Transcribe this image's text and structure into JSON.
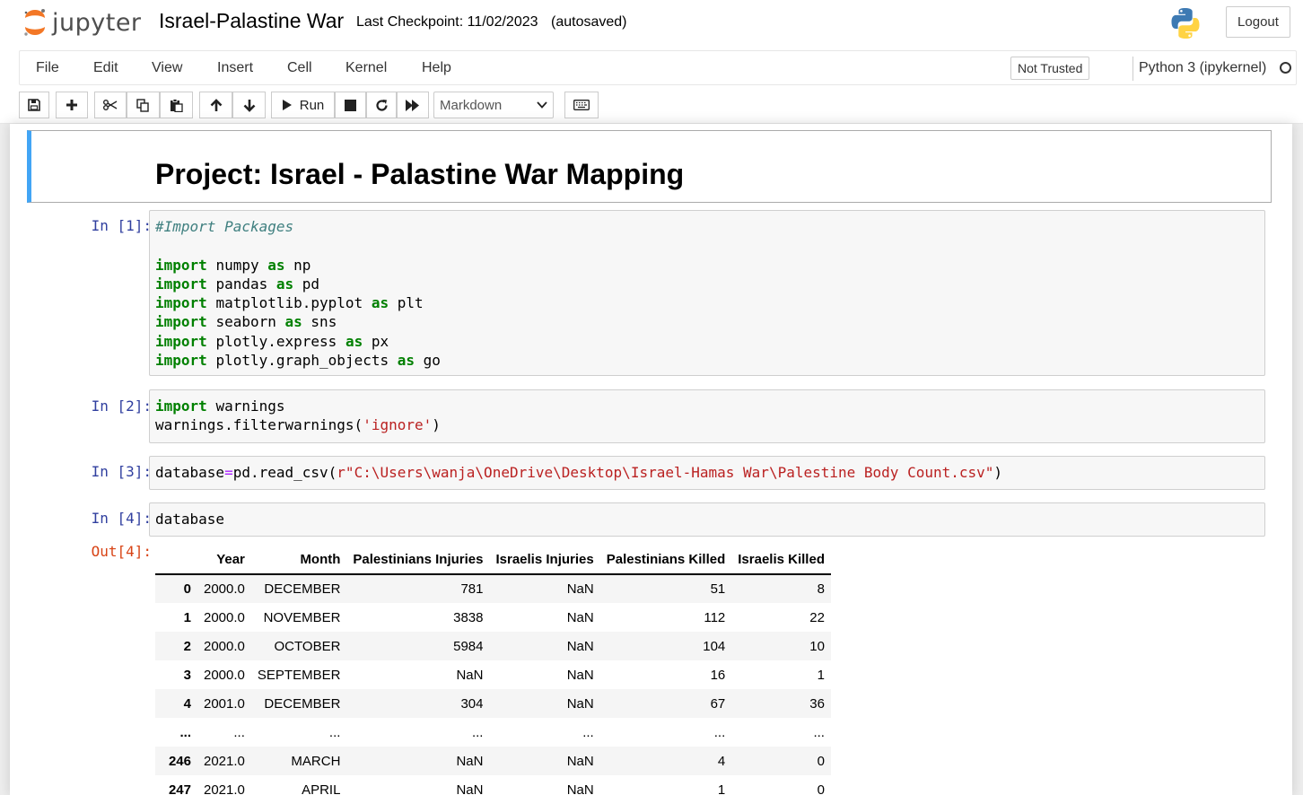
{
  "header": {
    "logo_text": "jupyter",
    "notebook_name": "Israel-Palastine War",
    "checkpoint": "Last Checkpoint: 11/02/2023",
    "autosave": "(autosaved)",
    "logout_label": "Logout"
  },
  "menubar": {
    "items": [
      "File",
      "Edit",
      "View",
      "Insert",
      "Cell",
      "Kernel",
      "Help"
    ],
    "trust_label": "Not Trusted",
    "kernel_name": "Python 3 (ipykernel)"
  },
  "toolbar": {
    "run_label": "Run",
    "cell_type": "Markdown",
    "icons": [
      "save-icon",
      "plus-icon",
      "scissors-icon",
      "copy-icon",
      "paste-icon",
      "arrow-up-icon",
      "arrow-down-icon",
      "play-icon",
      "stop-icon",
      "refresh-icon",
      "fast-forward-icon",
      "keyboard-icon"
    ]
  },
  "cells": {
    "markdown_heading": "Project: Israel - Palastine War Mapping",
    "c1": {
      "prompt": "In [1]:",
      "comment": "#Import Packages",
      "imports": [
        {
          "kw": "import",
          "mod": "numpy",
          "as": "as",
          "alias": "np"
        },
        {
          "kw": "import",
          "mod": "pandas",
          "as": "as",
          "alias": "pd"
        },
        {
          "kw": "import",
          "mod": "matplotlib.pyplot",
          "as": "as",
          "alias": "plt"
        },
        {
          "kw": "import",
          "mod": "seaborn",
          "as": "as",
          "alias": "sns"
        },
        {
          "kw": "import",
          "mod": "plotly.express",
          "as": "as",
          "alias": "px"
        },
        {
          "kw": "import",
          "mod": "plotly.graph_objects",
          "as": "as",
          "alias": "go"
        }
      ]
    },
    "c2": {
      "prompt": "In [2]:",
      "kw": "import",
      "mod": "warnings",
      "call": "warnings.filterwarnings(",
      "arg": "'ignore'",
      "close": ")"
    },
    "c3": {
      "prompt": "In [3]:",
      "var": "database",
      "eq": "=",
      "call": "pd.read_csv(",
      "arg": "r\"C:\\Users\\wanja\\OneDrive\\Desktop\\Israel-Hamas War\\Palestine Body Count.csv\"",
      "close": ")"
    },
    "c4": {
      "prompt": "In [4]:",
      "code": "database",
      "out_prompt": "Out[4]:"
    }
  },
  "dataframe": {
    "columns": [
      "",
      "Year",
      "Month",
      "Palestinians Injuries",
      "Israelis Injuries",
      "Palestinians Killed",
      "Israelis Killed"
    ],
    "rows": [
      [
        "0",
        "2000.0",
        "DECEMBER",
        "781",
        "NaN",
        "51",
        "8"
      ],
      [
        "1",
        "2000.0",
        "NOVEMBER",
        "3838",
        "NaN",
        "112",
        "22"
      ],
      [
        "2",
        "2000.0",
        "OCTOBER",
        "5984",
        "NaN",
        "104",
        "10"
      ],
      [
        "3",
        "2000.0",
        "SEPTEMBER",
        "NaN",
        "NaN",
        "16",
        "1"
      ],
      [
        "4",
        "2001.0",
        "DECEMBER",
        "304",
        "NaN",
        "67",
        "36"
      ],
      [
        "...",
        "...",
        "...",
        "...",
        "...",
        "...",
        "..."
      ],
      [
        "246",
        "2021.0",
        "MARCH",
        "NaN",
        "NaN",
        "4",
        "0"
      ],
      [
        "247",
        "2021.0",
        "APRIL",
        "NaN",
        "NaN",
        "1",
        "0"
      ]
    ]
  }
}
